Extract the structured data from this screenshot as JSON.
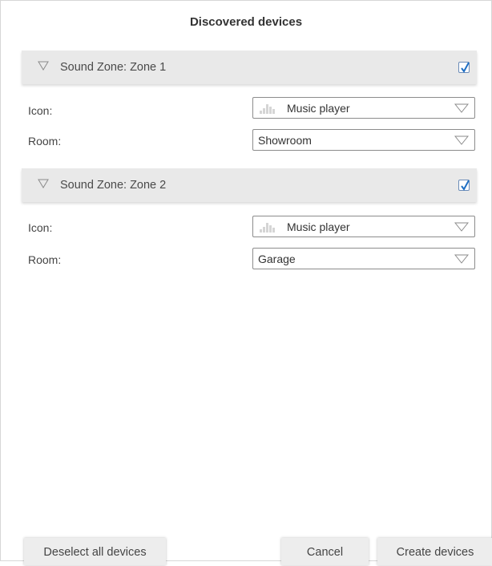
{
  "dialog": {
    "title": "Discovered devices"
  },
  "zones": [
    {
      "title": "Sound Zone: Zone 1",
      "checked": true,
      "icon_label": "Icon:",
      "icon_value": "Music player",
      "icon_name": "equalizer-icon",
      "room_label": "Room:",
      "room_value": "Showroom"
    },
    {
      "title": "Sound Zone: Zone 2",
      "checked": true,
      "icon_label": "Icon:",
      "icon_value": "Music player",
      "icon_name": "equalizer-icon",
      "room_label": "Room:",
      "room_value": "Garage"
    }
  ],
  "buttons": {
    "deselect_all": "Deselect all devices",
    "cancel": "Cancel",
    "create": "Create devices"
  },
  "colors": {
    "header_bg": "#e9e9e9",
    "checkbox_check": "#1f6fc4",
    "button_bg": "#ededed"
  }
}
